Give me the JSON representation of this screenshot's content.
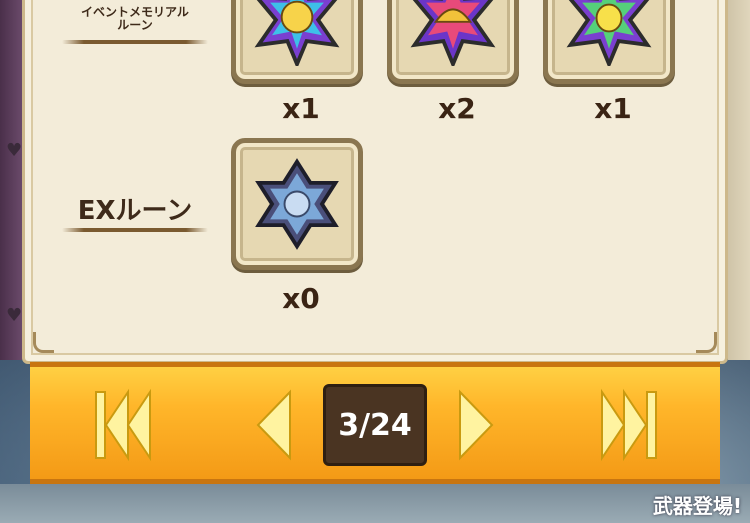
{
  "runes": {
    "event_memorial": {
      "label": "イベントメモリアル\nルーン",
      "items": [
        {
          "icon": "cheese-star-rune-icon",
          "count": "x1"
        },
        {
          "icon": "helmet-star-rune-icon",
          "count": "x2"
        },
        {
          "icon": "bird-star-rune-icon",
          "count": "x1"
        }
      ]
    },
    "ex": {
      "label": "EXルーン",
      "items": [
        {
          "icon": "ex-star-rune-icon",
          "count": "x0"
        }
      ]
    }
  },
  "pagination": {
    "current": "3/24",
    "first_icon": "first-page-icon",
    "prev_icon": "prev-page-icon",
    "next_icon": "next-page-icon",
    "last_icon": "last-page-icon"
  },
  "background": {
    "banner_text": "武器登場!"
  },
  "colors": {
    "parchment": "#f3ecd9",
    "nav_bar": "#ffb62a",
    "page_box": "#4a3422"
  }
}
